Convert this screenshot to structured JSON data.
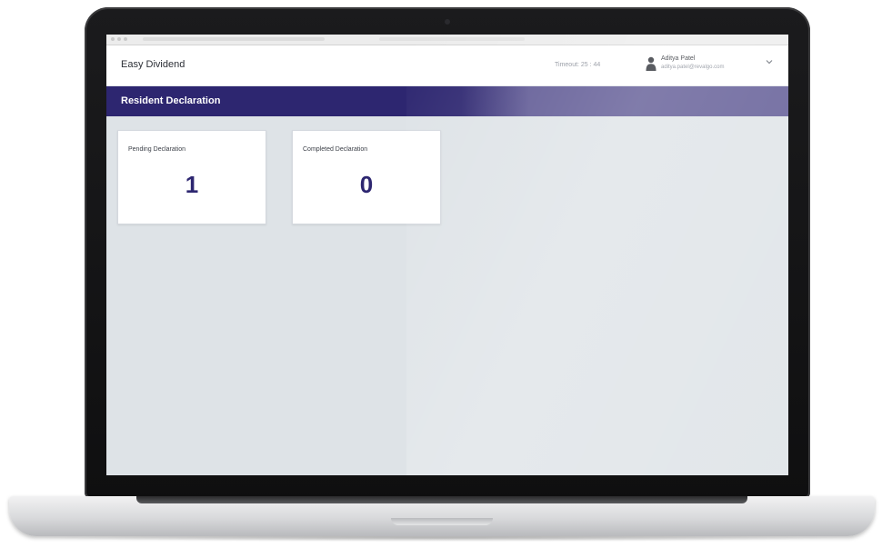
{
  "app": {
    "brand": "Easy Dividend",
    "timeout": "Timeout: 25 : 44"
  },
  "user": {
    "name": "Aditya Patel",
    "email": "aditya.patel@revalgo.com",
    "icon": "user-icon"
  },
  "page": {
    "title": "Resident Declaration"
  },
  "cards": [
    {
      "label": "Pending Declaration",
      "value": "1"
    },
    {
      "label": "Completed Declaration",
      "value": "0"
    }
  ],
  "colors": {
    "primary": "#2d2670",
    "primary_light": "#5d5793",
    "page_background": "#dee3e7",
    "header_background": "#ffffff"
  }
}
